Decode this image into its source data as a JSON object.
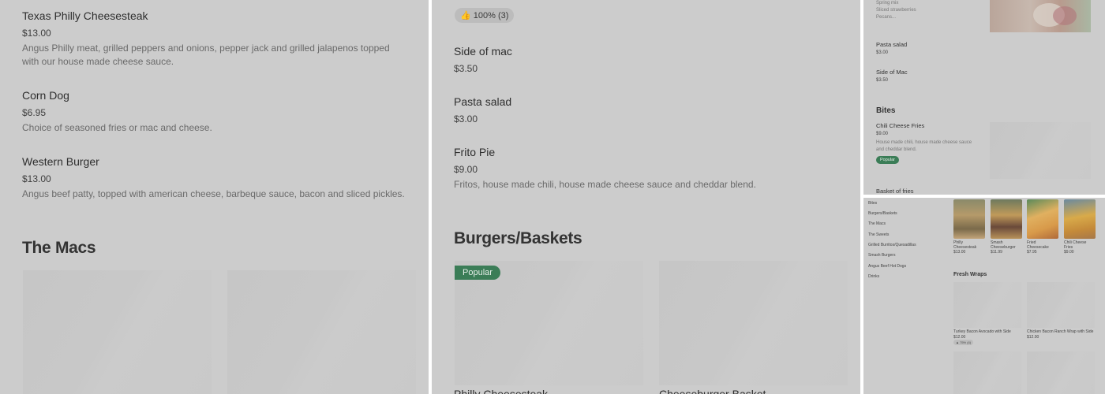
{
  "panel1": {
    "items": [
      {
        "name": "Texas Philly Cheesesteak",
        "price": "$13.00",
        "desc_l1": "Angus Philly meat, grilled peppers and onions, pepper jack and grilled jalapenos topped",
        "desc_l2": "with our house made cheese sauce."
      },
      {
        "name": "Corn Dog",
        "price": "$6.95",
        "desc": "Choice of seasoned fries or mac and cheese."
      },
      {
        "name": "Western Burger",
        "price": "$13.00",
        "desc": "Angus beef patty, topped with american cheese, barbeque sauce, bacon and sliced pickles."
      }
    ],
    "section": "The Macs"
  },
  "panel2": {
    "rating": "100% (3)",
    "items": [
      {
        "name": "Side of mac",
        "price": "$3.50"
      },
      {
        "name": "Pasta salad",
        "price": "$3.00"
      },
      {
        "name": "Frito Pie",
        "price": "$9.00",
        "desc": "Fritos, house made chili, house made cheese sauce and cheddar blend."
      }
    ],
    "section": "Burgers/Baskets",
    "popular": "Popular",
    "cards": [
      "Philly Cheesesteak",
      "Cheeseburger Basket"
    ]
  },
  "panel3": {
    "top_desc": [
      "Spring mix",
      "Sliced strawberries",
      "Pecans..."
    ],
    "items": [
      {
        "name": "Pasta salad",
        "price": "$3.00"
      },
      {
        "name": "Side of Mac",
        "price": "$3.50"
      }
    ],
    "section": "Bites",
    "bite": {
      "name": "Chili Cheese Fries",
      "price": "$9.00",
      "desc_l1": "House made chili, house made cheese sauce",
      "desc_l2": "and cheddar blend.",
      "popular": "Popular"
    },
    "next_item": "Basket of fries"
  },
  "panel4": {
    "nav": [
      "Bites",
      "Burgers/Baskets",
      "The Macs",
      "The Sweets",
      "Grilled Burritos/Quesadillas",
      "Smash Burgers",
      "Angus Beef Hot Dogs",
      "Drinks"
    ],
    "thumbs": [
      {
        "name_l1": "Philly",
        "name_l2": "Cheesesteak",
        "price": "$13.00"
      },
      {
        "name_l1": "Smash",
        "name_l2": "Cheeseburger",
        "price": "$11.99"
      },
      {
        "name_l1": "Fried",
        "name_l2": "Cheesecake",
        "price": "$7.95"
      },
      {
        "name_l1": "Chili Cheese",
        "name_l2": "Fries",
        "price": "$9.00"
      }
    ],
    "section": "Fresh Wraps",
    "wraps": [
      {
        "name": "Turkey Bacon Avocado with Side",
        "price": "$12.00",
        "rating": "75% (4)"
      },
      {
        "name": "Chicken Bacon Ranch Wrap with Side",
        "price": "$12.00"
      }
    ]
  }
}
